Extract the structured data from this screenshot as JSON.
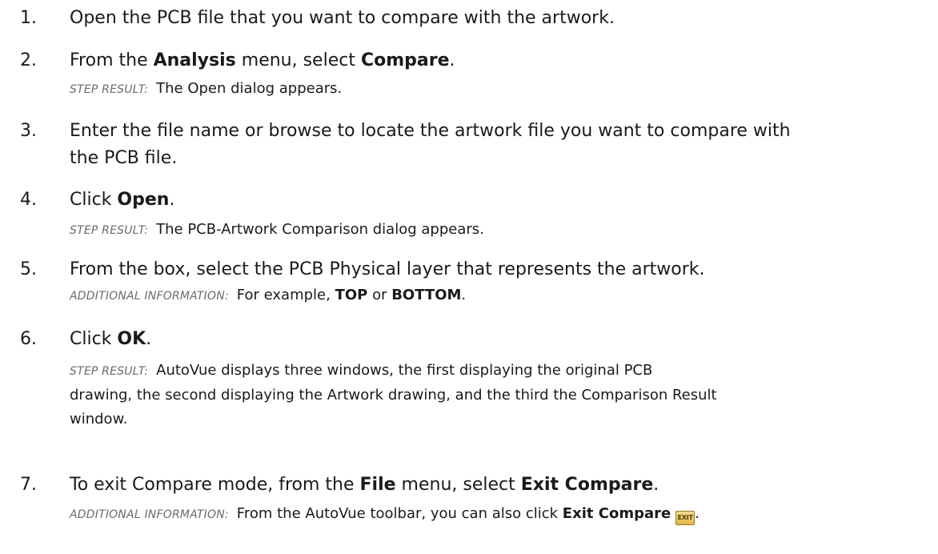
{
  "steps": [
    {
      "number": "1.",
      "text": "Open the PCB file that you want to compare with the artwork."
    },
    {
      "number": "2.",
      "parts": [
        "From the ",
        "Analysis",
        " menu, select ",
        "Compare",
        "."
      ],
      "result_label": "STEP RESULT:",
      "result": "The Open dialog appears."
    },
    {
      "number": "3.",
      "line1": "Enter the file name or browse to locate the artwork file you want to compare with",
      "line2": "the PCB file."
    },
    {
      "number": "4.",
      "parts": [
        "Click ",
        "Open",
        "."
      ],
      "result_label": "STEP RESULT:",
      "result": "The PCB-Artwork Comparison dialog appears."
    },
    {
      "number": "5.",
      "text": "From the box, select the PCB Physical layer that represents the artwork.",
      "info_label": "ADDITIONAL INFORMATION:",
      "info_parts": [
        "For example, ",
        "TOP",
        " or ",
        "BOTTOM",
        "."
      ]
    },
    {
      "number": "6.",
      "parts": [
        "Click ",
        "OK",
        "."
      ],
      "result_label": "STEP RESULT:",
      "result_line1": "AutoVue displays three windows, the first displaying the original PCB",
      "result_line2": "drawing, the second displaying the Artwork drawing, and the third the Comparison Result",
      "result_line3": "window."
    },
    {
      "number": "7.",
      "parts": [
        "To exit Compare mode, from the ",
        "File",
        " menu, select ",
        "Exit Compare",
        "."
      ],
      "info_label": "ADDITIONAL INFORMATION:",
      "info_parts": [
        "From the AutoVue toolbar, you can also click ",
        "Exit Compare",
        "."
      ],
      "icon": {
        "name": "exit-compare-icon",
        "text": "EXIT"
      }
    }
  ]
}
